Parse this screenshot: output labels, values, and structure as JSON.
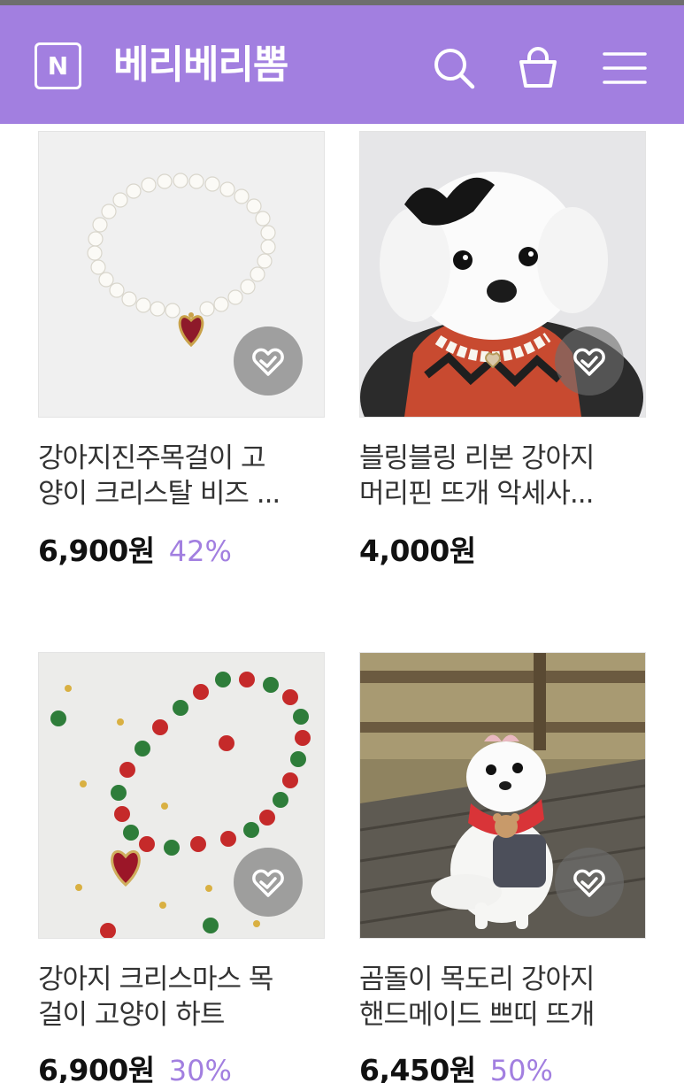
{
  "header": {
    "logo_letter": "N",
    "store_name": "베리베리뽐",
    "icons": [
      "search-icon",
      "shopping-bag-icon",
      "hamburger-menu-icon"
    ],
    "accent_color": "#a27fe0"
  },
  "products": [
    {
      "title_line1": "강아지진주목걸이 고",
      "title_line2": "양이 크리스탈 비즈 ...",
      "price": "6,900원",
      "discount": "42%"
    },
    {
      "title_line1": "블링블링 리본 강아지",
      "title_line2": "머리핀 뜨개 악세사...",
      "price": "4,000원",
      "discount": ""
    },
    {
      "title_line1": "강아지 크리스마스 목",
      "title_line2": "걸이 고양이 하트",
      "price": "6,900원",
      "discount": "30%"
    },
    {
      "title_line1": "곰돌이 목도리 강아지",
      "title_line2": "핸드메이드 쁘띠 뜨개",
      "price": "6,450원",
      "discount": "50%"
    }
  ]
}
